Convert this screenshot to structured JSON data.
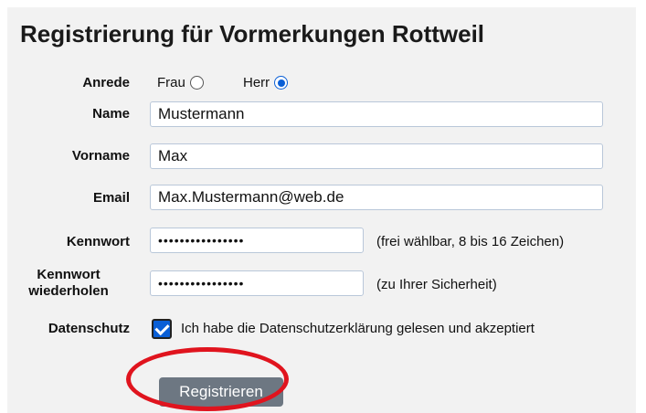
{
  "form": {
    "title": "Registrierung für Vormerkungen Rottweil",
    "salutation": {
      "label": "Anrede",
      "options": [
        "Frau",
        "Herr"
      ],
      "selected": "Herr"
    },
    "name": {
      "label": "Name",
      "value": "Mustermann"
    },
    "firstname": {
      "label": "Vorname",
      "value": "Max"
    },
    "email": {
      "label": "Email",
      "value": "Max.Mustermann@web.de"
    },
    "password": {
      "label": "Kennwort",
      "value": "••••••••••••••••",
      "hint": "(frei wählbar, 8 bis 16 Zeichen)"
    },
    "password_repeat": {
      "label_line1": "Kennwort",
      "label_line2": "wiederholen",
      "value": "••••••••••••••••",
      "hint": "(zu Ihrer Sicherheit)"
    },
    "privacy": {
      "label": "Datenschutz",
      "checkbox_text": "Ich habe die Datenschutzerklärung gelesen und akzeptiert",
      "checked": true
    },
    "submit_label": "Registrieren"
  },
  "colors": {
    "panel_bg": "#f2f2f2",
    "accent": "#0a5fd6",
    "button_bg": "#6d7782",
    "highlight": "#e0141e"
  }
}
